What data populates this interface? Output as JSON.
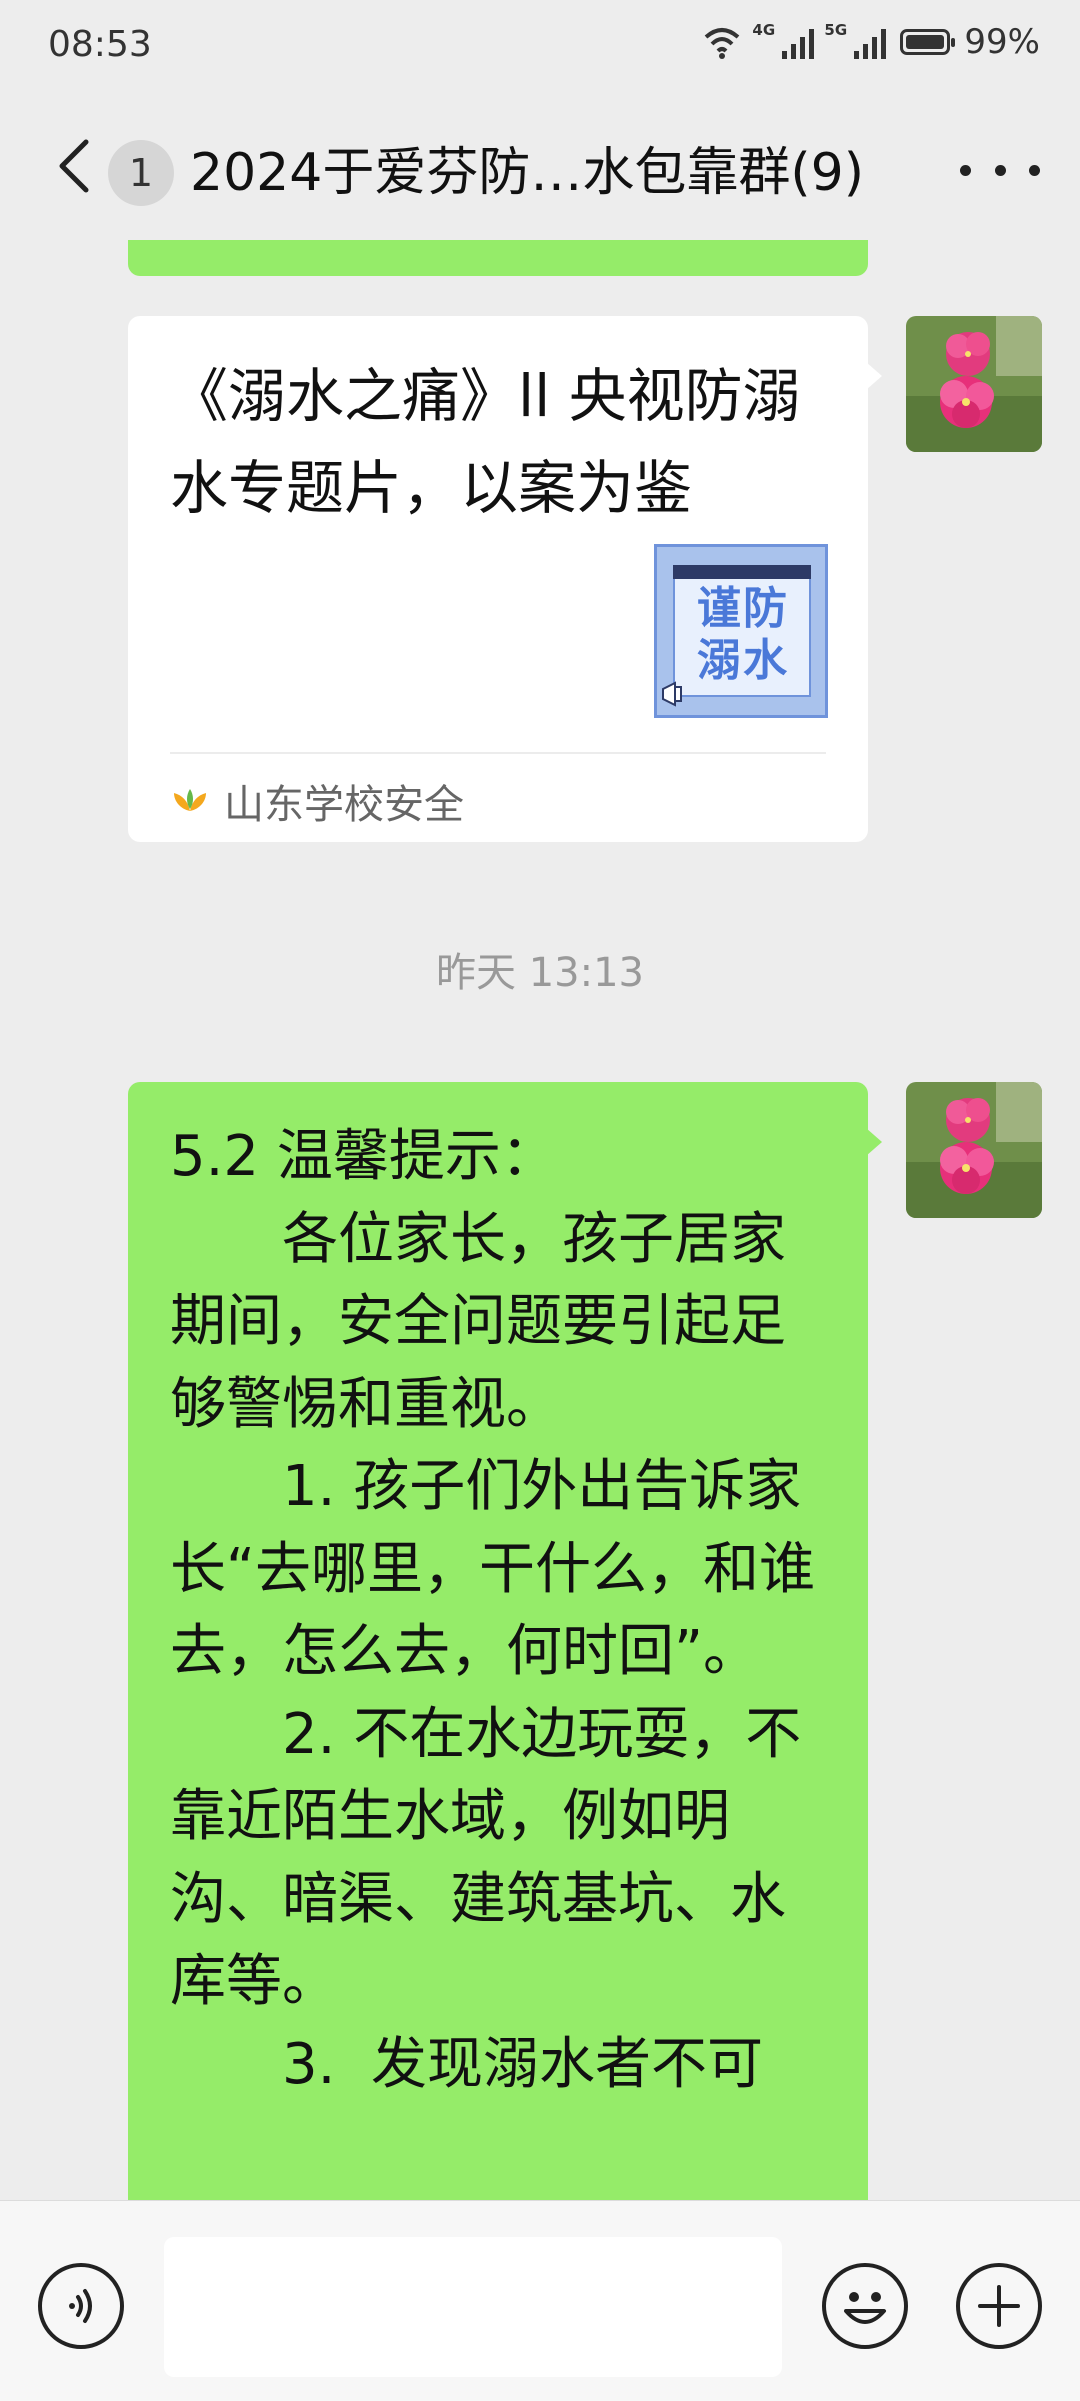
{
  "status_bar": {
    "time": "08:53",
    "network_1": "4G",
    "network_2": "5G",
    "battery": "99%"
  },
  "header": {
    "unread_count": "1",
    "title": "2024于爱芬防…水包靠群(9)"
  },
  "messages": {
    "link_card": {
      "title": "《溺水之痛》ll 央视防溺水专题片，以案为鉴",
      "thumbnail_text": "谨防溺水",
      "source": "山东学校安全"
    },
    "timestamp": "昨天 13:13",
    "text_message": "5.2 温馨提示：\n　　各位家长，孩子居家期间，安全问题要引起足够警惕和重视。\n　　1. 孩子们外出告诉家长“去哪里，干什么，和谁去，怎么去，何时回”。\n　　2. 不在水边玩耍，不靠近陌生水域，例如明沟、暗渠、建筑基坑、水库等。\n　　3.  发现溺水者不可"
  },
  "colors": {
    "background": "#ededed",
    "sent_bubble": "#95ec69",
    "card": "#ffffff"
  },
  "icons": {
    "back": "chevron-left-icon",
    "more": "more-dots-icon",
    "voice": "voice-icon",
    "emoji": "emoji-icon",
    "add": "plus-icon"
  }
}
